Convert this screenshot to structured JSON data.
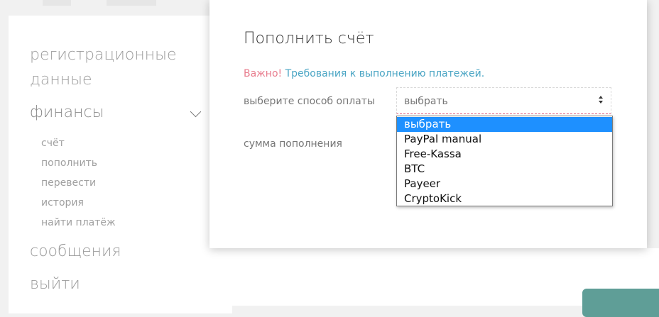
{
  "sidebar": {
    "items": [
      {
        "label": "регистрационные"
      },
      {
        "label": "данные"
      },
      {
        "label": "финансы"
      },
      {
        "label": "сообщения"
      },
      {
        "label": "выйти"
      }
    ],
    "finance_subitems": [
      {
        "label": "счёт"
      },
      {
        "label": "пополнить"
      },
      {
        "label": "перевести"
      },
      {
        "label": "история"
      },
      {
        "label": "найти платёж"
      }
    ]
  },
  "card": {
    "title": "Пополнить счёт",
    "important_label": "Важно!",
    "requirements_link": "Требования к выполнению платежей.",
    "payment_method_label": "выберите способ оплаты",
    "amount_label": "сумма пополнения",
    "select_value": "выбрать",
    "options": [
      {
        "label": "выбрать",
        "selected": true
      },
      {
        "label": "PayPal manual",
        "selected": false
      },
      {
        "label": "Free-Kassa",
        "selected": false
      },
      {
        "label": "BTC",
        "selected": false
      },
      {
        "label": "Payeer",
        "selected": false
      },
      {
        "label": "CryptoKick",
        "selected": false
      }
    ]
  },
  "colors": {
    "warn": "#e87c8d",
    "link": "#4aa5c4",
    "selected_option": "#1e90ff",
    "corner_button": "#5f9e97"
  }
}
